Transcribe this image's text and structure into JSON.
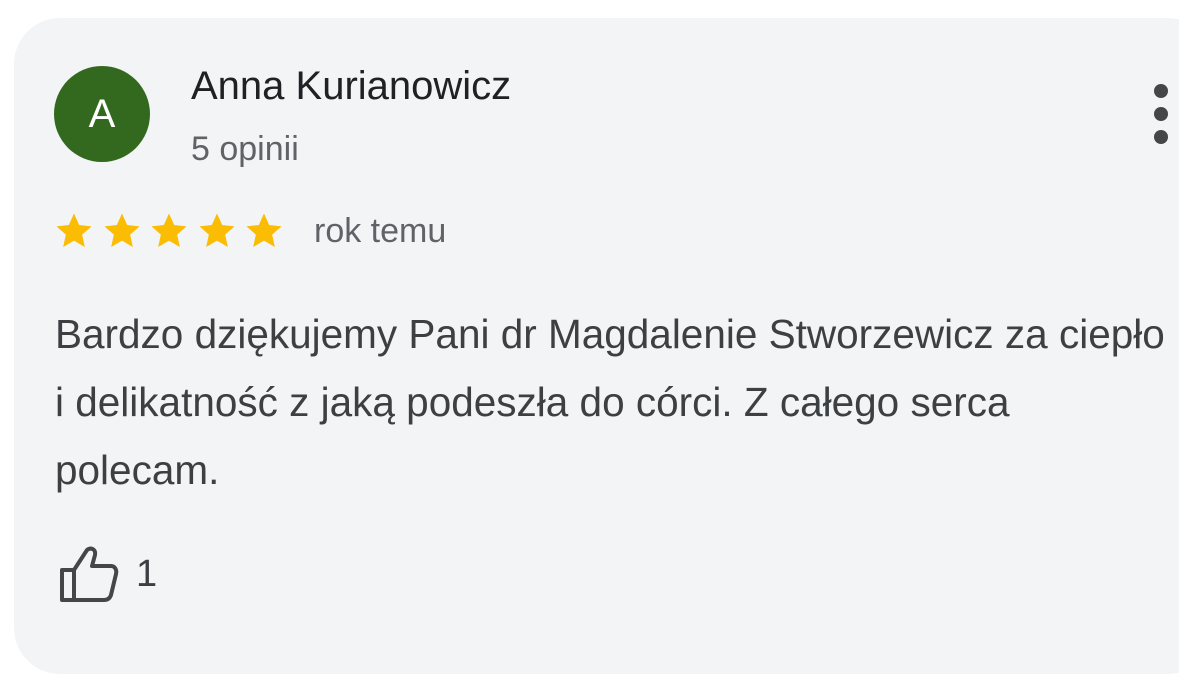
{
  "review": {
    "author": {
      "initial": "A",
      "name": "Anna Kurianowicz",
      "reviews_count": "5 opinii",
      "avatar_color": "#33691e"
    },
    "rating": 5,
    "rating_max": 5,
    "star_color": "#fbbc04",
    "time_ago": "rok temu",
    "text": "Bardzo dziękujemy Pani dr Magdalenie Stworzewicz za ciepło i delikatność z jaką podeszła do córci. Z całego serca polecam.",
    "likes": "1",
    "icons": {
      "like": "thumbs-up-icon",
      "more": "more-vertical-icon",
      "star": "star-icon"
    }
  }
}
